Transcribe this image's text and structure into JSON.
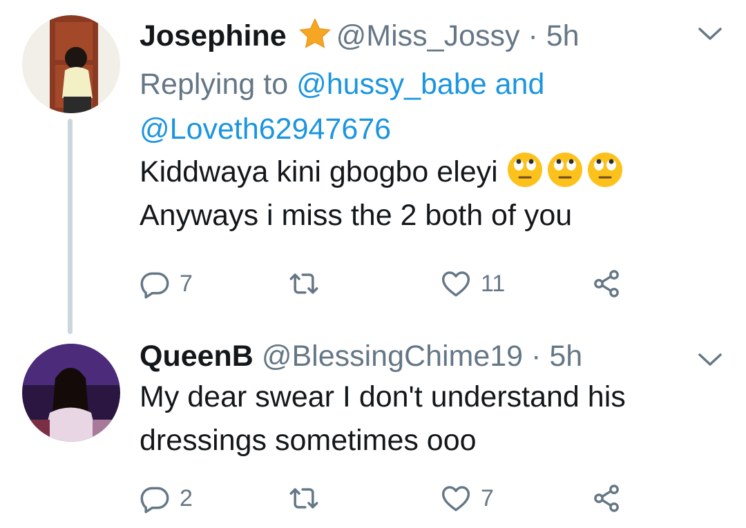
{
  "tweets": [
    {
      "author_name": "Josephine",
      "verified_icon": "star-icon",
      "handle": "@Miss_Jossy",
      "separator": "·",
      "time": "5h",
      "replying_prefix": "Replying to",
      "replying_mention_1": "@hussy_babe",
      "replying_and": "and",
      "replying_mention_2": "@Loveth62947676",
      "line1": "Kiddwaya kini gbogbo eleyi",
      "line1_emoji": [
        "face-with-rolling-eyes",
        "face-with-rolling-eyes",
        "face-with-rolling-eyes"
      ],
      "line2": "Anyways i miss the 2 both of you",
      "reply_count": "7",
      "retweet_count": "",
      "like_count": "11"
    },
    {
      "author_name": "QueenB",
      "handle": "@BlessingChime19",
      "separator": "·",
      "time": "5h",
      "line1": "My dear swear I don't understand his",
      "line2": "dressings sometimes ooo",
      "reply_count": "2",
      "retweet_count": "",
      "like_count": "7"
    }
  ],
  "colors": {
    "text": "#14171a",
    "secondary": "#657786",
    "link": "#1b95e0",
    "thread_line": "#ccd6dd",
    "star": "#f5a623"
  }
}
